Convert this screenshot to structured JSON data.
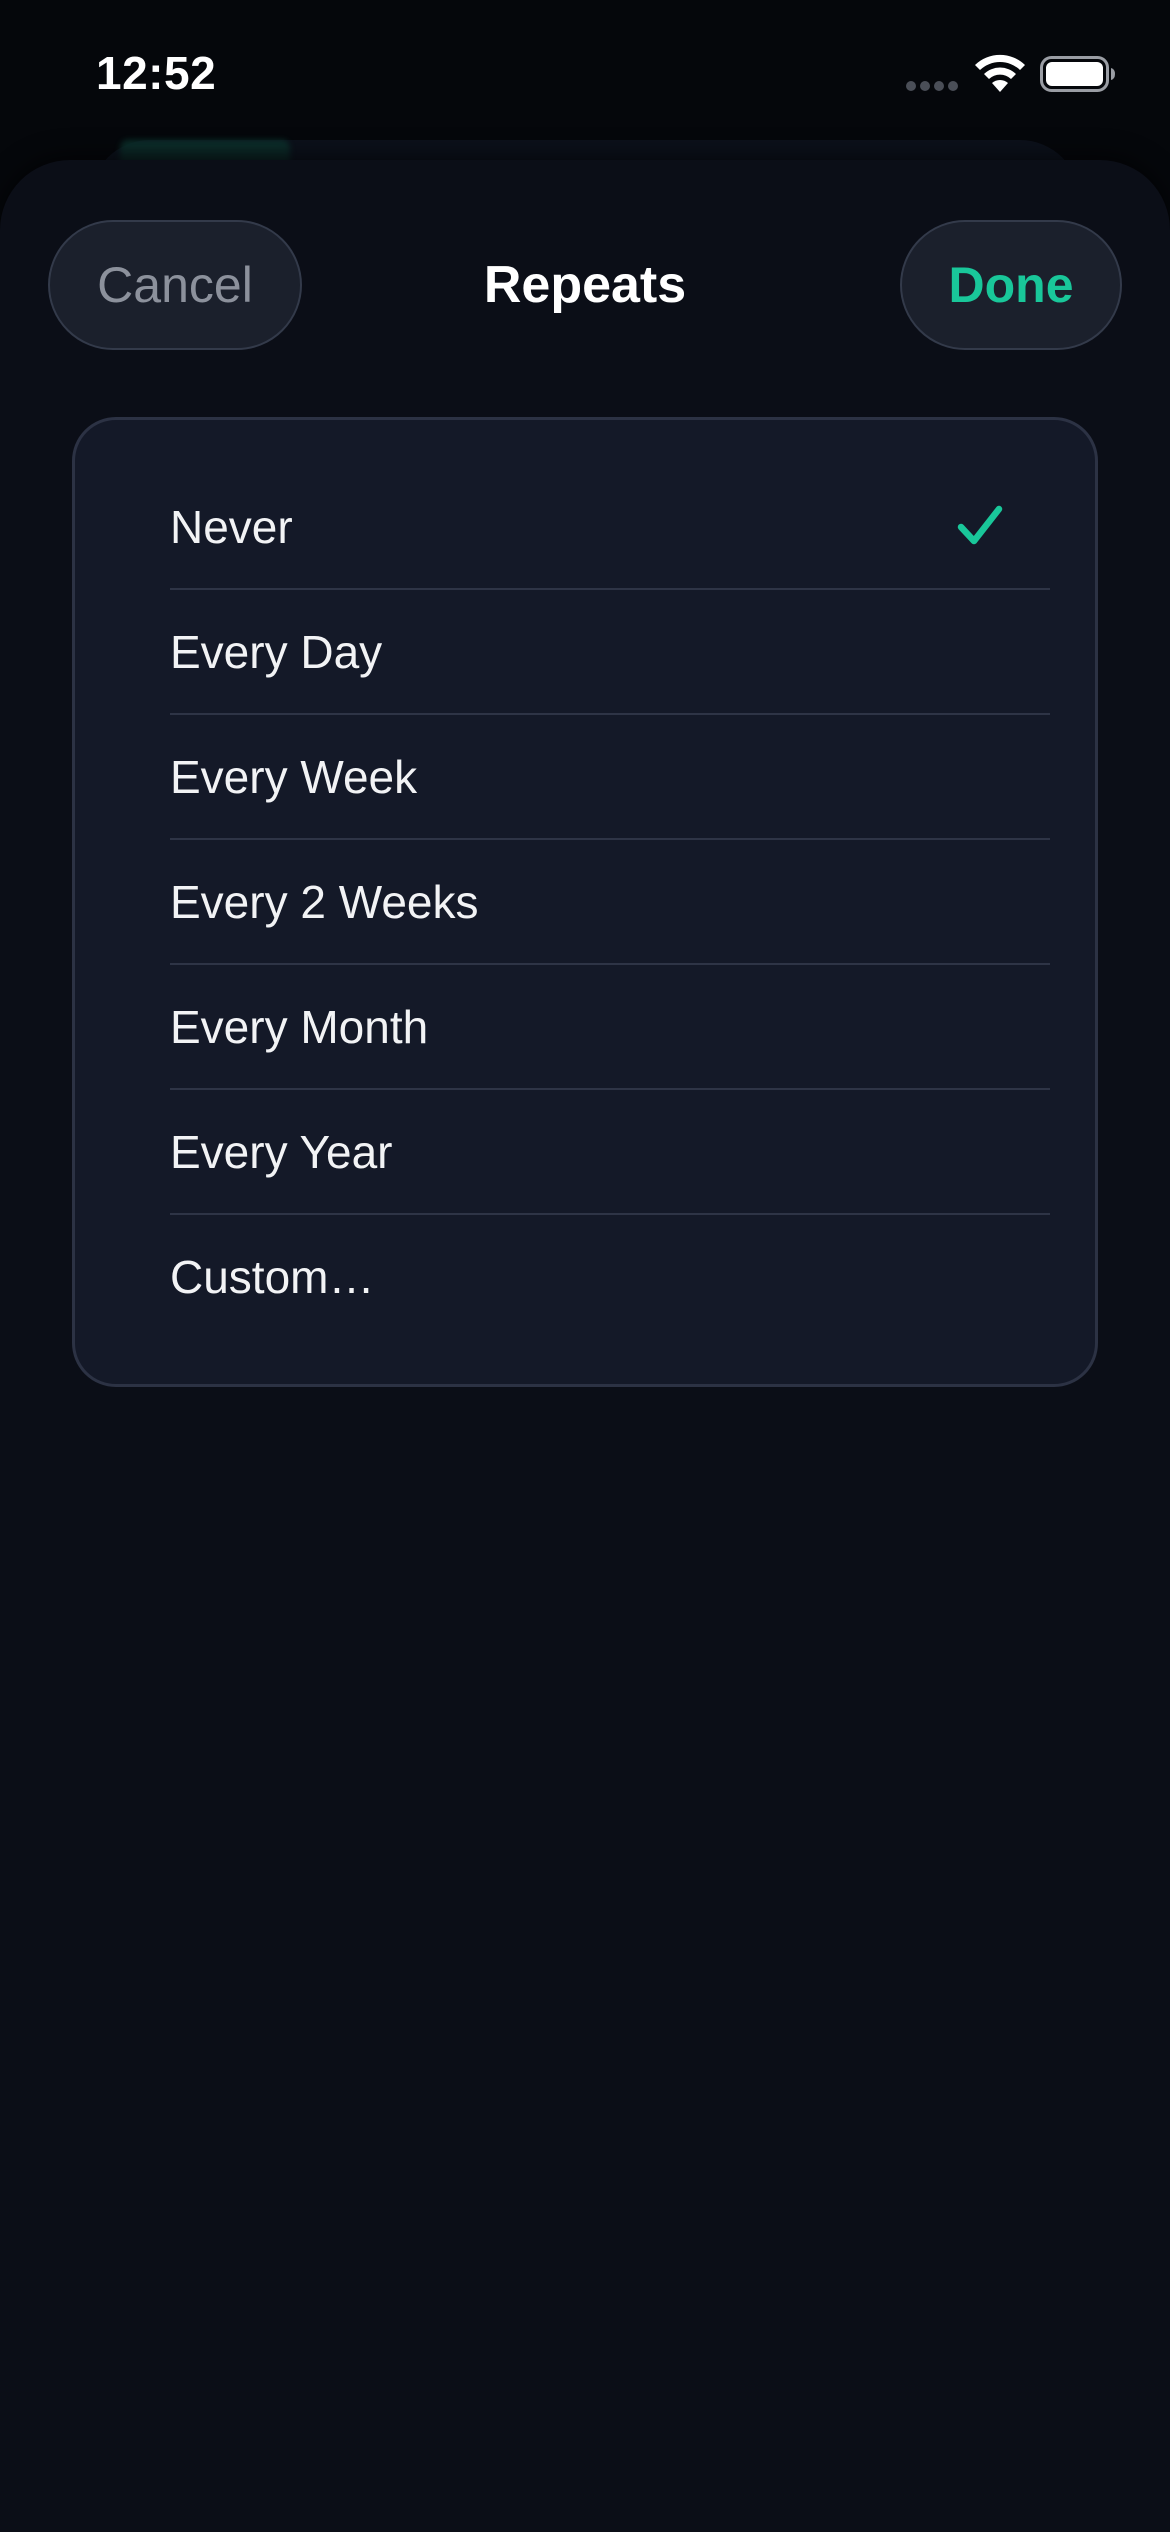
{
  "status_bar": {
    "time": "12:52",
    "signal_icon": "cellular-signal-icon",
    "wifi_icon": "wifi-icon",
    "battery_icon": "battery-icon"
  },
  "nav": {
    "cancel_label": "Cancel",
    "title": "Repeats",
    "done_label": "Done"
  },
  "options": [
    {
      "label": "Never",
      "selected": true
    },
    {
      "label": "Every Day",
      "selected": false
    },
    {
      "label": "Every Week",
      "selected": false
    },
    {
      "label": "Every 2 Weeks",
      "selected": false
    },
    {
      "label": "Every Month",
      "selected": false
    },
    {
      "label": "Every Year",
      "selected": false
    },
    {
      "label": "Custom…",
      "selected": false
    }
  ],
  "colors": {
    "accent": "#19c79a",
    "background": "#0b0e17",
    "card": "#141928",
    "muted_text": "#8c919c"
  }
}
